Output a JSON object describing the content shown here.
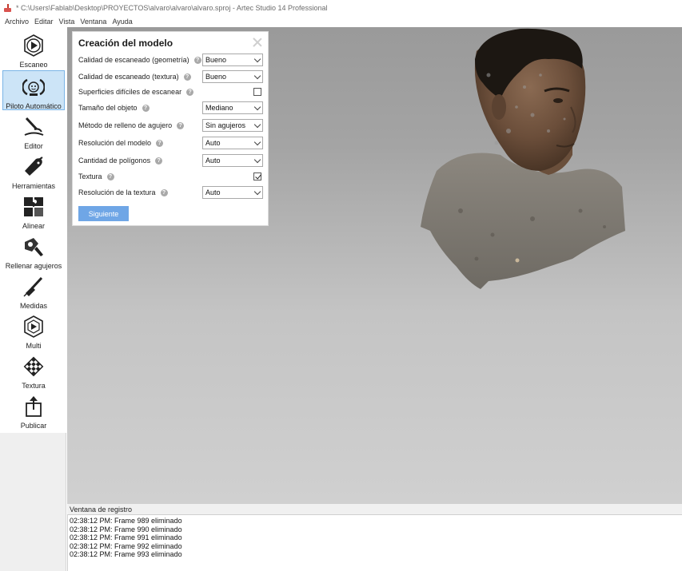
{
  "window": {
    "title": "* C:\\Users\\Fablab\\Desktop\\PROYECTOS\\alvaro\\alvaro\\alvaro.sproj - Artec Studio 14 Professional"
  },
  "menu": [
    "Archivo",
    "Editar",
    "Vista",
    "Ventana",
    "Ayuda"
  ],
  "toolbar": {
    "items": [
      {
        "label": "Escaneo",
        "icon": "scan-icon"
      },
      {
        "label": "Piloto Automático",
        "icon": "autopilot-icon",
        "active": true
      },
      {
        "label": "Editor",
        "icon": "editor-icon"
      },
      {
        "label": "Herramientas",
        "icon": "tools-icon"
      },
      {
        "label": "Alinear",
        "icon": "align-icon"
      },
      {
        "label": "Rellenar agujeros",
        "icon": "fill-holes-icon"
      },
      {
        "label": "Medidas",
        "icon": "measures-icon"
      },
      {
        "label": "Multi",
        "icon": "multi-icon"
      },
      {
        "label": "Textura",
        "icon": "texture-icon"
      },
      {
        "label": "Publicar",
        "icon": "publish-icon"
      }
    ]
  },
  "dialog": {
    "title": "Creación del modelo",
    "fields": [
      {
        "label": "Calidad de escaneado (geometría)",
        "type": "select",
        "value": "Bueno"
      },
      {
        "label": "Calidad de escaneado (textura)",
        "type": "select",
        "value": "Bueno"
      },
      {
        "label": "Superficies difíciles de escanear",
        "type": "checkbox",
        "checked": false
      },
      {
        "label": "Tamaño del objeto",
        "type": "select",
        "value": "Mediano"
      },
      {
        "label": "Método de relleno de agujero",
        "type": "select",
        "value": "Sin agujeros"
      },
      {
        "label": "Resolución del modelo",
        "type": "select",
        "value": "Auto"
      },
      {
        "label": "Cantidad de polígonos",
        "type": "select",
        "value": "Auto"
      },
      {
        "label": "Textura",
        "type": "checkbox",
        "checked": true
      },
      {
        "label": "Resolución de la textura",
        "type": "select",
        "value": "Auto"
      }
    ],
    "next_label": "Siguiente"
  },
  "log": {
    "title": "Ventana de registro",
    "lines": [
      "02:38:12 PM: Frame 989 eliminado",
      "02:38:12 PM: Frame 990 eliminado",
      "02:38:12 PM: Frame 991 eliminado",
      "02:38:12 PM: Frame 992 eliminado",
      "02:38:12 PM: Frame 993 eliminado"
    ]
  },
  "colors": {
    "accent": "#6fa6e6",
    "active_tool_bg": "#cce4f7",
    "viewport_top": "#9a9a9a",
    "viewport_bottom": "#d0d0d0"
  }
}
